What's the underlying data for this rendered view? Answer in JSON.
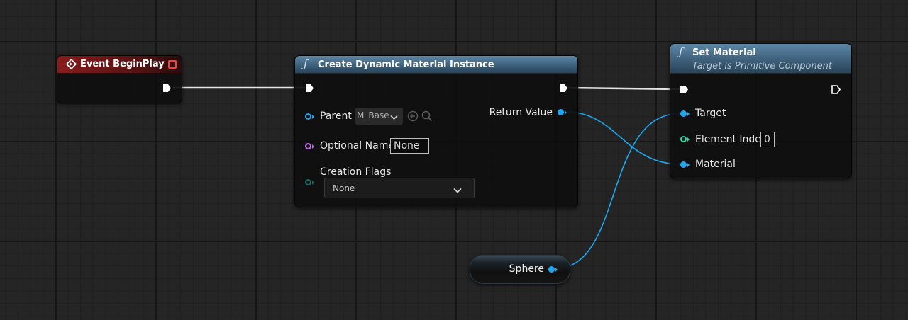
{
  "graph": {
    "event_begin_play": {
      "title": "Event BeginPlay",
      "icon": "event-diamond-icon",
      "header_color": "#8a1b1b"
    },
    "create_dynamic_material_instance": {
      "title": "Create Dynamic Material Instance",
      "icon": "function-icon",
      "inputs": {
        "parent": {
          "label": "Parent",
          "value": "M_Base"
        },
        "optional_name": {
          "label": "Optional Name",
          "value": "None"
        },
        "creation_flags": {
          "label": "Creation Flags",
          "value": "None"
        }
      },
      "outputs": {
        "return_value": {
          "label": "Return Value"
        }
      }
    },
    "set_material": {
      "title": "Set Material",
      "subtitle": "Target is Primitive Component",
      "icon": "function-icon",
      "inputs": {
        "target": {
          "label": "Target"
        },
        "element_index": {
          "label": "Element Index",
          "value": "0"
        },
        "material": {
          "label": "Material"
        }
      }
    },
    "sphere_variable": {
      "label": "Sphere"
    }
  },
  "colors": {
    "object_pin": "#1ca8f0",
    "string_pin": "#c06ae8",
    "byte_pin": "#1a6c60",
    "int_pin": "#1fe0a8",
    "exec_pin": "#ffffff",
    "function_header": "#3b5d78"
  }
}
